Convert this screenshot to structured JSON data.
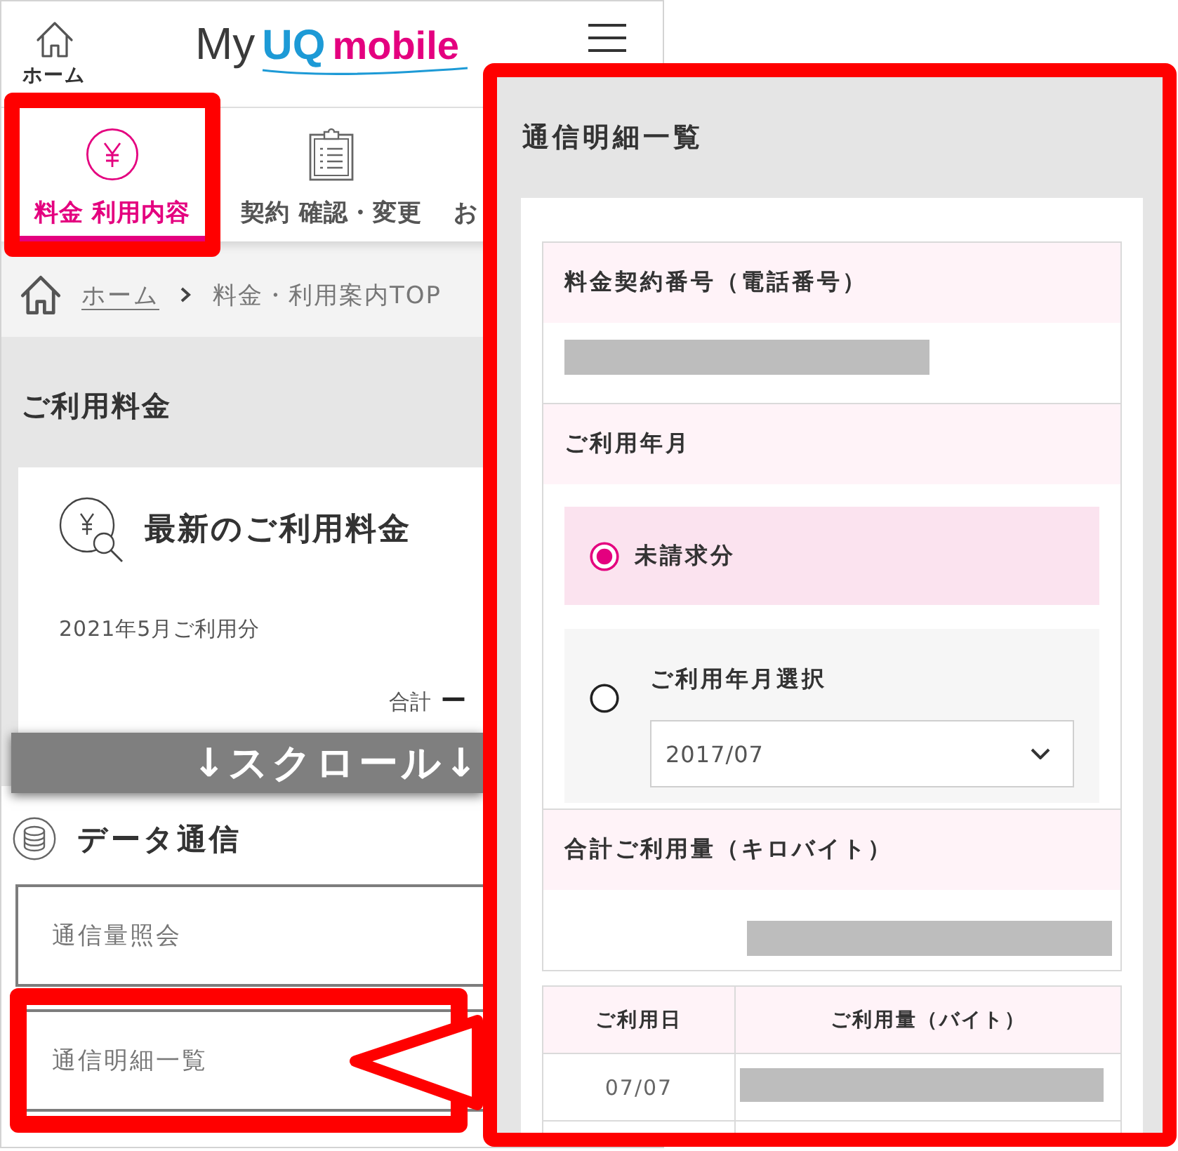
{
  "header": {
    "home": {
      "label": "ホーム"
    },
    "logo": [
      {
        "text": "My",
        "kind": "plain"
      },
      {
        "text": "UQ",
        "kind": "brand"
      },
      {
        "text": "mobile",
        "kind": "accent"
      }
    ]
  },
  "nav_tabs": [
    {
      "label": "料金 利用内容",
      "selected": true,
      "highlighted": true
    },
    {
      "label": "契約 確認・変更",
      "selected": false,
      "highlighted": false
    },
    {
      "label": "お",
      "selected": false,
      "highlighted": false
    }
  ],
  "breadcrumb": [
    {
      "label": "ホーム",
      "kind": "link"
    },
    {
      "label": "料金・利用案内TOP",
      "kind": "current"
    }
  ],
  "billing": {
    "heading": "ご利用料金",
    "card": {
      "title": "最新のご利用料金",
      "period": "2021年5月ご利用分",
      "total_label": "合計",
      "total_value": "ー"
    }
  },
  "scroll_banner": {
    "text": "↓スクロール↓"
  },
  "data_section": {
    "heading": "データ通信",
    "links": [
      {
        "label": "通信量照会",
        "highlighted": false
      },
      {
        "label": "通信明細一覧",
        "highlighted": true
      }
    ]
  },
  "detail_panel": {
    "title": "通信明細一覧",
    "fields": [
      {
        "label": "料金契約番号（電話番号）",
        "kind": "text",
        "redacted": true
      },
      {
        "label": "ご利用年月",
        "kind": "choice",
        "options": [
          {
            "kind": "plain",
            "label": "未請求分",
            "selected": true
          },
          {
            "kind": "select",
            "label": "ご利用年月選択",
            "value": "2017/07",
            "selected": false
          }
        ]
      },
      {
        "label": "合計ご利用量（キロバイト）",
        "kind": "amount",
        "redacted": true
      }
    ],
    "table": {
      "columns": [
        "ご利用日",
        "ご利用量（バイト）"
      ],
      "rows": [
        {
          "date": "07/07",
          "redacted": true
        }
      ]
    }
  }
}
